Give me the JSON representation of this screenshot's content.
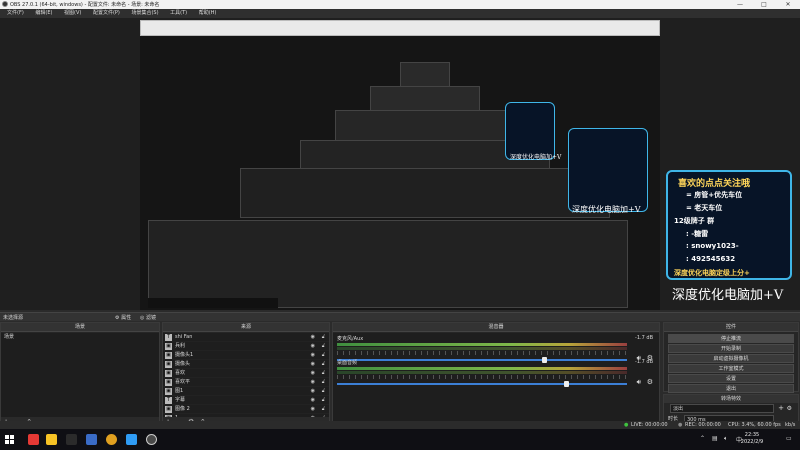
{
  "window": {
    "title": "OBS 27.0.1 (64-bit, windows) - 配置文件: 未命名 - 场景: 未命名",
    "controls": [
      "—",
      "□",
      "✕"
    ]
  },
  "menu": [
    "文件(F)",
    "编辑(E)",
    "视图(V)",
    "配置文件(P)",
    "场景集合(S)",
    "工具(T)",
    "帮助(H)"
  ],
  "promo": {
    "title": "喜欢的点点关注哦",
    "lines": [
      "= 房管+优先车位",
      "= 老天车位",
      "12级牌子 群",
      ": -糖雷",
      ": snowy1023-",
      ": 492545632",
      "深度优化电脑定级上分+"
    ],
    "caption": "深度优化电脑加+V"
  },
  "dock": {
    "label": "未选择源",
    "props_label": "属性",
    "filters_label": "滤镜"
  },
  "scenes": {
    "header": "场景",
    "items": [
      "场景"
    ]
  },
  "sources": {
    "header": "来源",
    "items": [
      {
        "icon": "T",
        "name": "shi Fan"
      },
      {
        "icon": "▣",
        "name": "兵利"
      },
      {
        "icon": "▣",
        "name": "摄像头1"
      },
      {
        "icon": "▣",
        "name": "摄像头"
      },
      {
        "icon": "▣",
        "name": "喜欢"
      },
      {
        "icon": "▣",
        "name": "喜欢平"
      },
      {
        "icon": "▣",
        "name": "图1"
      },
      {
        "icon": "T",
        "name": "字幕"
      },
      {
        "icon": "▣",
        "name": "图像 2"
      },
      {
        "icon": "▣",
        "name": "1"
      }
    ]
  },
  "mixer": {
    "header": "混音器",
    "channels": [
      {
        "name": "麦克风/Aux",
        "db": "-1.7 dB"
      },
      {
        "name": "桌面音频",
        "db": "-1.7 dB"
      }
    ]
  },
  "controls": {
    "header": "控件",
    "buttons": [
      "停止推流",
      "开始录制",
      "启动虚拟摄像机",
      "工作室模式",
      "设置",
      "退出"
    ]
  },
  "transitions": {
    "header": "转场特效",
    "type_label": "淡出",
    "duration_label": "时长",
    "duration_value": "300 ms"
  },
  "status": {
    "live": "LIVE: 00:00:00",
    "rec": "REC: 00:00:00",
    "cpu": "CPU: 3.4%, 60.00 fps",
    "kb": "kb/s"
  },
  "taskbar": {
    "time": "22:35",
    "date": "2022/2/9",
    "icon_colors": [
      "#e53935",
      "#f7c325",
      "#2b2b2b",
      "#3a6cc7",
      "#e0a020",
      "#2f9cf5",
      "#4a4a4a"
    ]
  }
}
